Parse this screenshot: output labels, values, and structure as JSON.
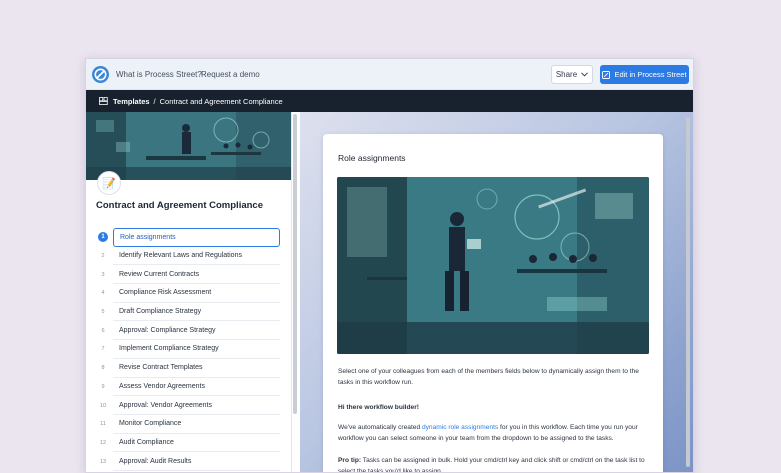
{
  "topbar": {
    "nav_what": "What is Process Street?",
    "nav_demo": "Request a demo",
    "share_label": "Share",
    "edit_label": "Edit in Process Street"
  },
  "breadcrumb": {
    "root": "Templates",
    "separator": "/",
    "current": "Contract and Agreement Compliance"
  },
  "sidebar": {
    "emoji": "📝",
    "title": "Contract and Agreement Compliance",
    "tasks": [
      {
        "num": "1",
        "label": "Role assignments"
      },
      {
        "num": "2",
        "label": "Identify Relevant Laws and Regulations"
      },
      {
        "num": "3",
        "label": "Review Current Contracts"
      },
      {
        "num": "4",
        "label": "Compliance Risk Assessment"
      },
      {
        "num": "5",
        "label": "Draft Compliance Strategy"
      },
      {
        "num": "6",
        "label": "Approval: Compliance Strategy"
      },
      {
        "num": "7",
        "label": "Implement Compliance Strategy"
      },
      {
        "num": "8",
        "label": "Revise Contract Templates"
      },
      {
        "num": "9",
        "label": "Assess Vendor Agreements"
      },
      {
        "num": "10",
        "label": "Approval: Vendor Agreements"
      },
      {
        "num": "11",
        "label": "Monitor Compliance"
      },
      {
        "num": "12",
        "label": "Audit Compliance"
      },
      {
        "num": "13",
        "label": "Approval: Audit Results"
      }
    ]
  },
  "card": {
    "title": "Role assignments",
    "p1": "Select one of your colleagues from each of the members fields below to dynamically assign them to the tasks in this workflow run.",
    "p2": "Hi there workflow builder!",
    "p3_pre": "We've automatically created ",
    "p3_link": "dynamic role assignments",
    "p3_post": " for you in this workflow. Each time you run your workflow you can select someone in your team from the dropdown to be assigned to the tasks.",
    "p4_bold": "Pro tip:",
    "p4_text": " Tasks can be assigned in bulk. Hold your cmd/ctrl key and click shift or cmd/ctrl on the task list to select the tasks you'd like to assign."
  },
  "colors": {
    "accent": "#2c7be5",
    "dark_bar": "#17222e"
  }
}
